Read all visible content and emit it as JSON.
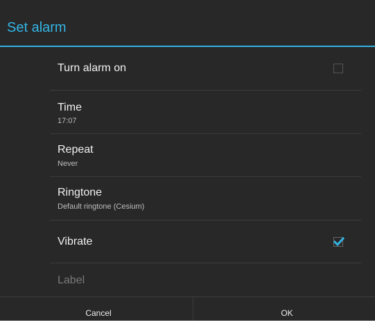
{
  "dialog": {
    "title": "Set alarm",
    "accent_color": "#33b5e5",
    "background_color": "#282828"
  },
  "rows": {
    "alarm_on": {
      "label": "Turn alarm on",
      "checked": false
    },
    "time": {
      "label": "Time",
      "value": "17:07"
    },
    "repeat": {
      "label": "Repeat",
      "value": "Never"
    },
    "ringtone": {
      "label": "Ringtone",
      "value": "Default ringtone (Cesium)"
    },
    "vibrate": {
      "label": "Vibrate",
      "checked": true
    },
    "label": {
      "label": "Label",
      "enabled": false
    }
  },
  "buttons": {
    "cancel": "Cancel",
    "ok": "OK"
  }
}
